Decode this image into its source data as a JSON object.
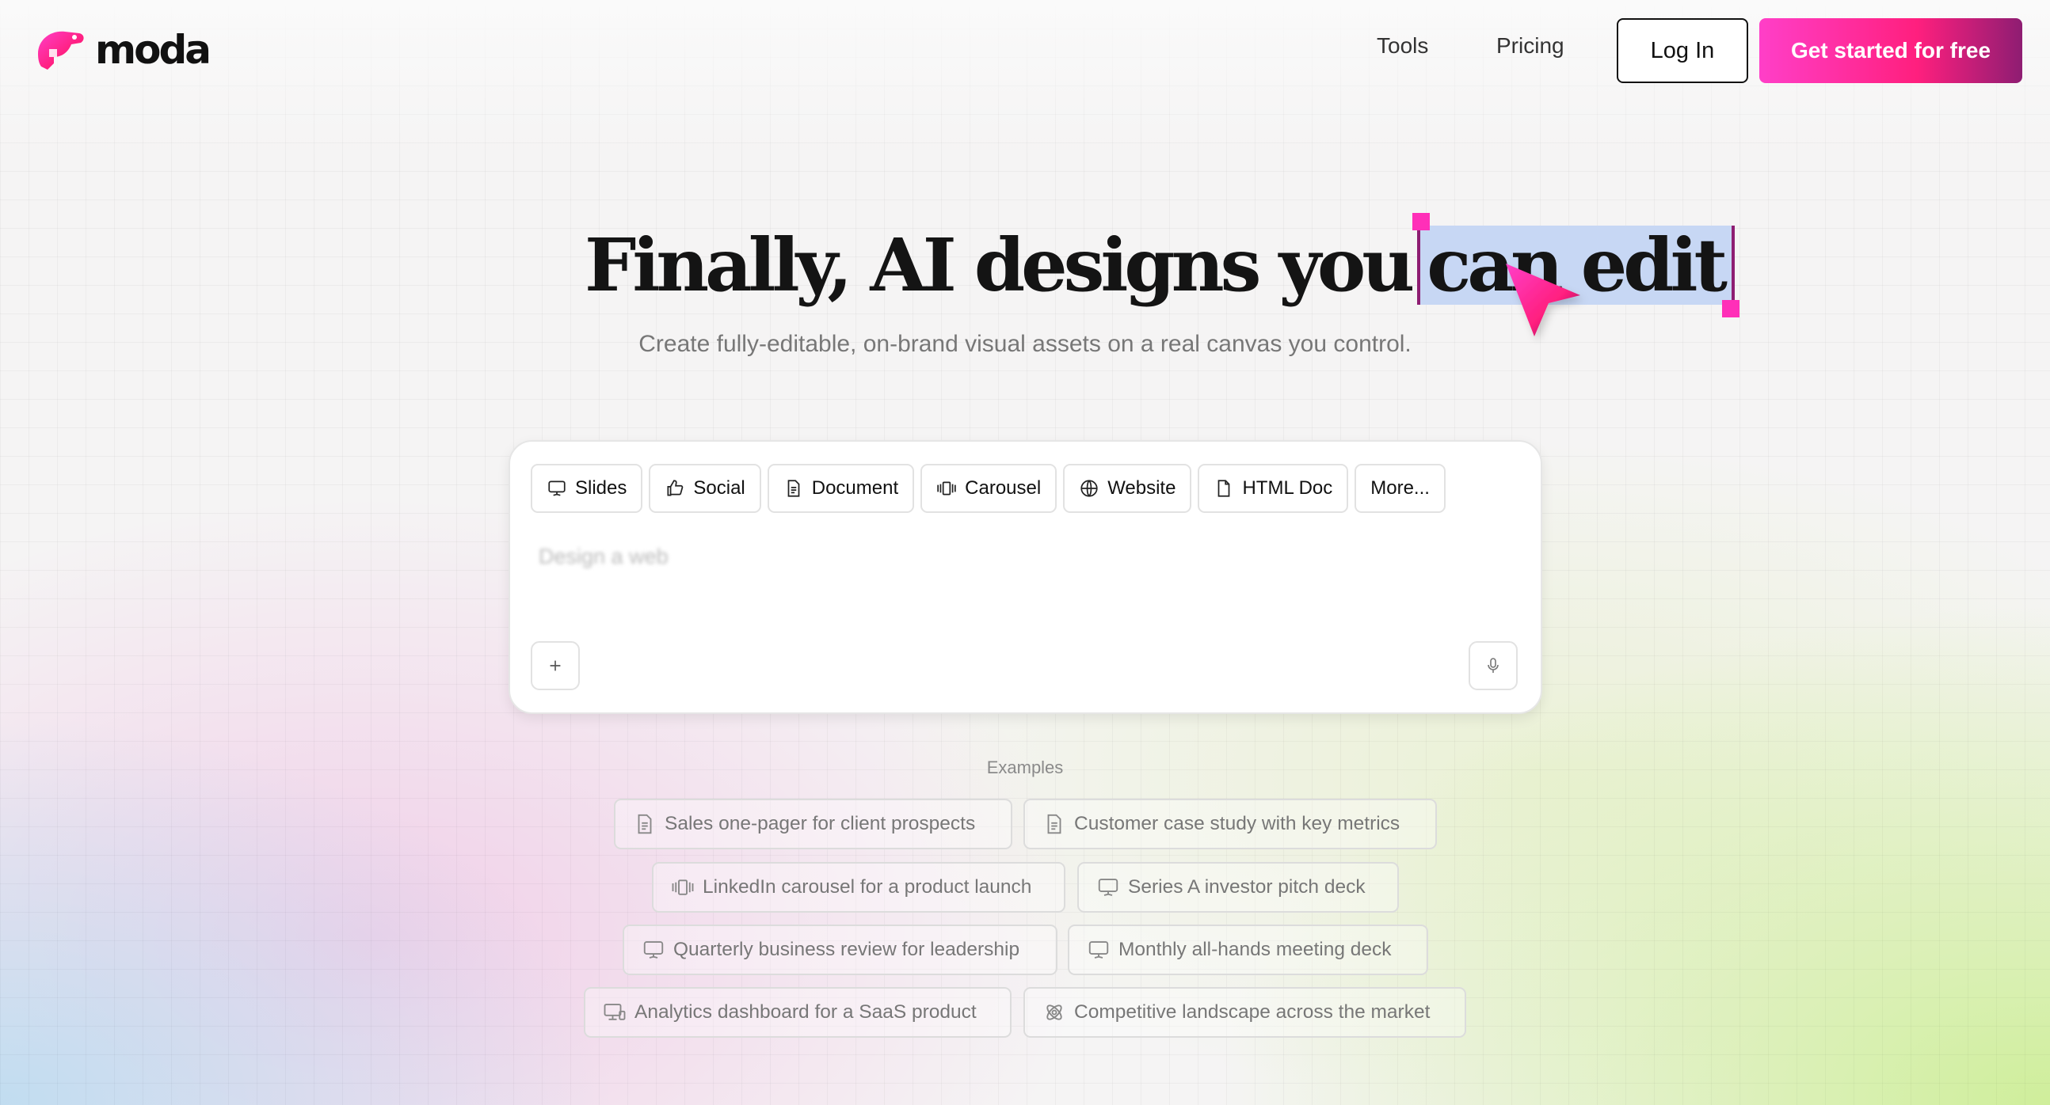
{
  "header": {
    "logo_text": "moda",
    "nav": [
      {
        "label": "Tools"
      },
      {
        "label": "Pricing"
      }
    ],
    "login_label": "Log In",
    "cta_label": "Get started for free"
  },
  "hero": {
    "headline_prefix": "Finally, AI designs you",
    "headline_highlight": "can edit",
    "subhead": "Create fully-editable, on-brand visual assets on a real canvas you control."
  },
  "prompt": {
    "chips": [
      {
        "label": "Slides",
        "icon": "slides-icon"
      },
      {
        "label": "Social",
        "icon": "thumbs-up-icon"
      },
      {
        "label": "Document",
        "icon": "document-icon"
      },
      {
        "label": "Carousel",
        "icon": "carousel-icon"
      },
      {
        "label": "Website",
        "icon": "globe-icon"
      },
      {
        "label": "HTML Doc",
        "icon": "file-icon"
      },
      {
        "label": "More..."
      }
    ],
    "placeholder": "Design a web",
    "add_icon": "plus-icon",
    "mic_icon": "microphone-icon"
  },
  "examples": {
    "label": "Examples",
    "items": [
      {
        "label": "Sales one-pager for client prospects",
        "icon": "document-icon"
      },
      {
        "label": "Customer case study with key metrics",
        "icon": "document-icon"
      },
      {
        "label": "LinkedIn carousel for a product launch",
        "icon": "carousel-icon"
      },
      {
        "label": "Series A investor pitch deck",
        "icon": "slides-icon"
      },
      {
        "label": "Quarterly business review for leadership",
        "icon": "slides-icon"
      },
      {
        "label": "Monthly all-hands meeting deck",
        "icon": "slides-icon"
      },
      {
        "label": "Analytics dashboard for a SaaS product",
        "icon": "devices-icon"
      },
      {
        "label": "Competitive landscape across the market",
        "icon": "atom-icon"
      }
    ]
  },
  "colors": {
    "brand_pink": "#ff2fb8",
    "brand_plum": "#8e1d72",
    "highlight": "#c7d7f4"
  }
}
